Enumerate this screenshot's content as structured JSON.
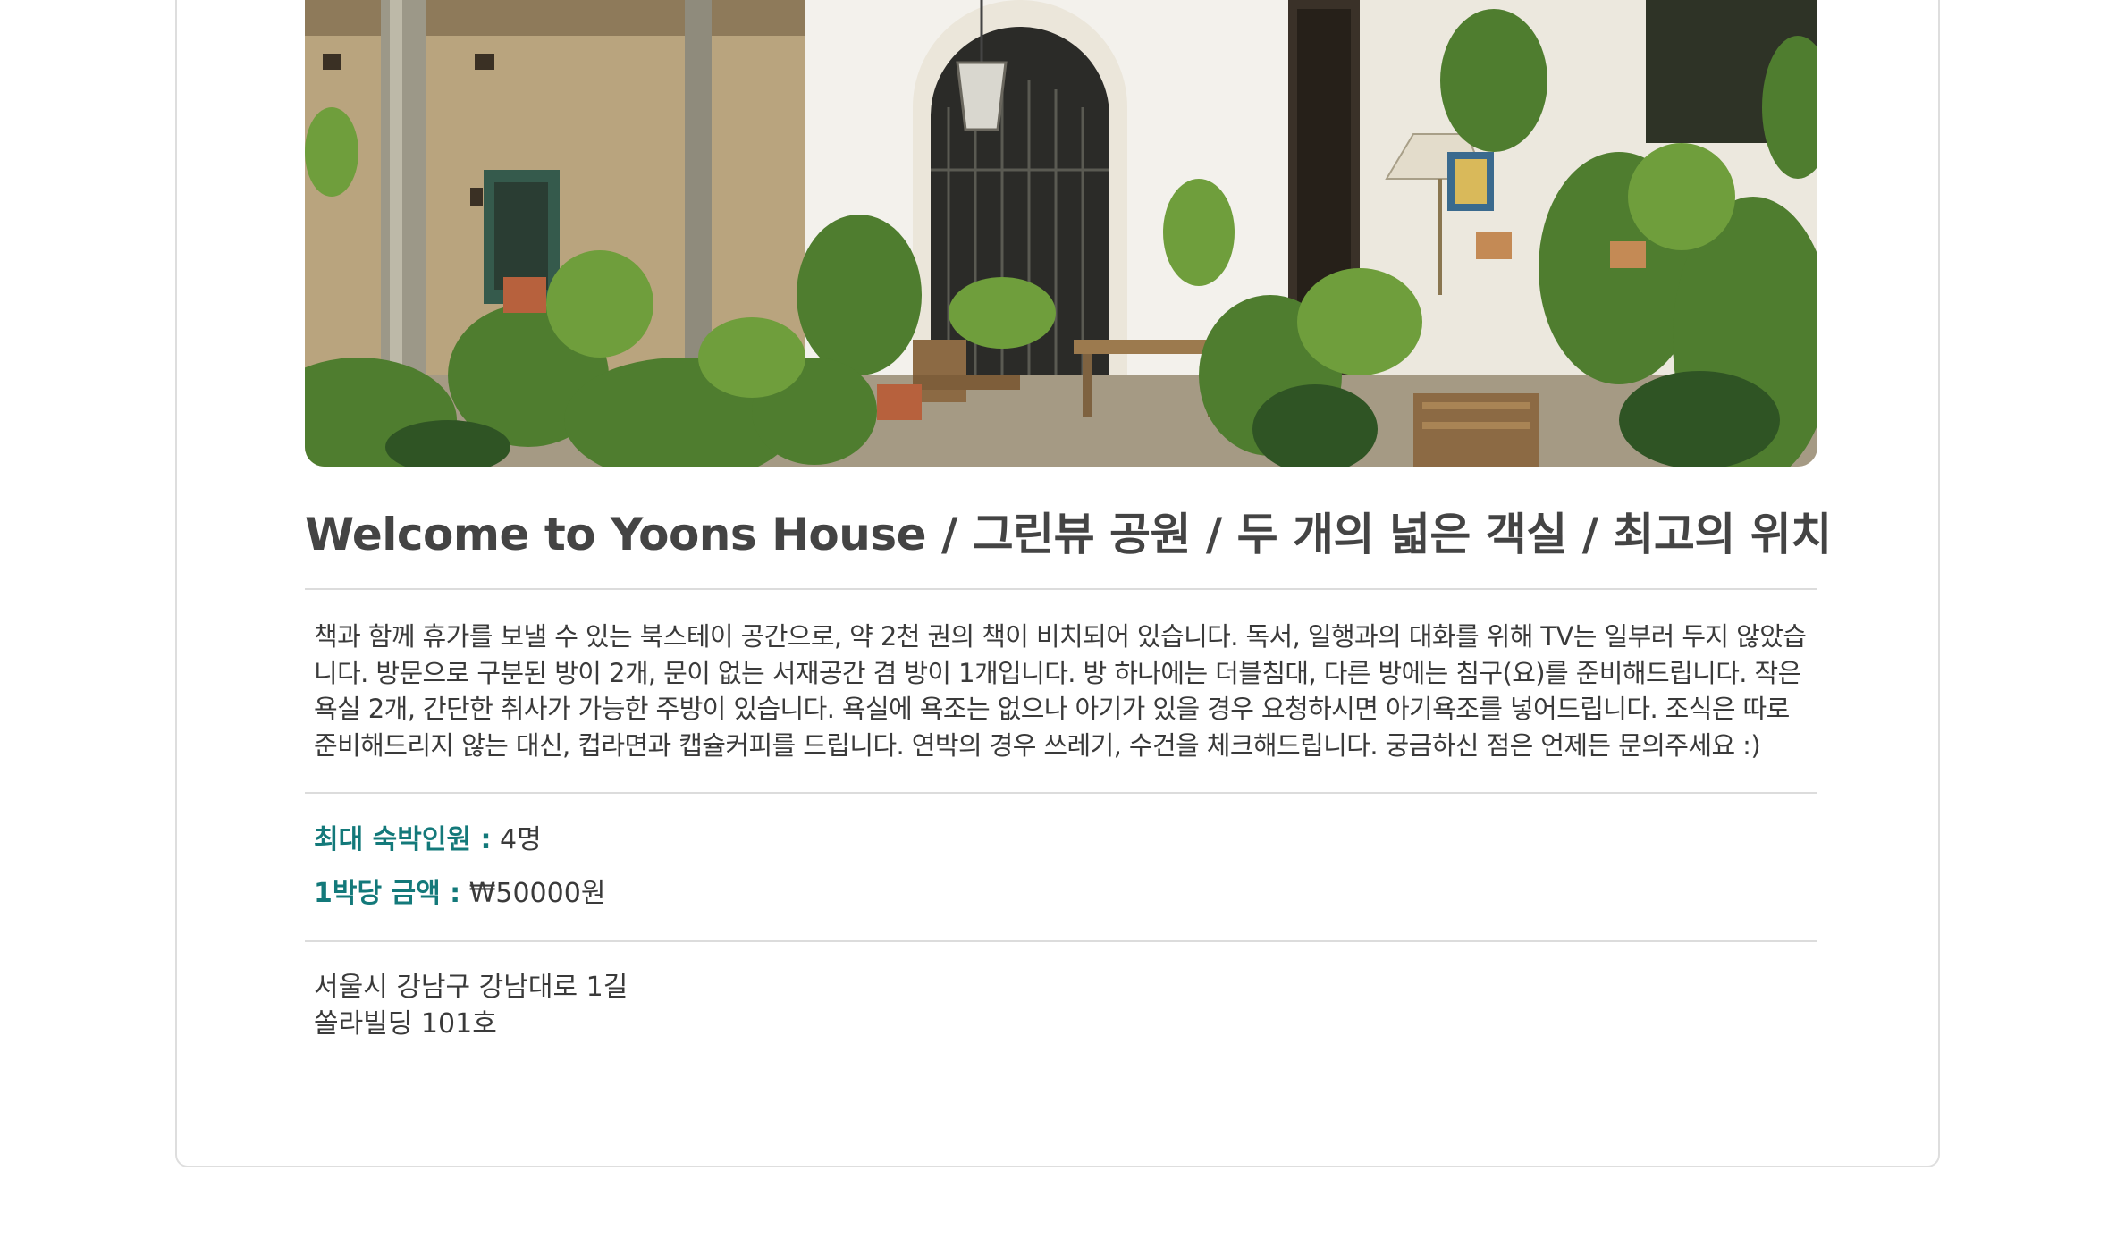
{
  "listing": {
    "photo": "covered terrace with potted plants, wooden table and chairs, arched iron gate",
    "title": "Welcome to Yoons House / 그린뷰 공원 / 두 개의 넓은 객실 / 최고의 위치",
    "description": "책과 함께 휴가를 보낼 수 있는 북스테이 공간으로, 약 2천 권의 책이 비치되어 있습니다. 독서, 일행과의 대화를 위해 TV는 일부러 두지 않았습니다. 방문으로 구분된 방이 2개, 문이 없는 서재공간 겸 방이 1개입니다. 방 하나에는 더블침대, 다른 방에는 침구(요)를 준비해드립니다. 작은 욕실 2개, 간단한 취사가 가능한 주방이 있습니다. 욕실에 욕조는 없으나 아기가 있을 경우 요청하시면 아기욕조를 넣어드립니다. 조식은 따로 준비해드리지 않는 대신, 컵라면과 캡슐커피를 드립니다. 연박의 경우 쓰레기, 수건을 체크해드립니다. 궁금하신 점은 언제든 문의주세요 :)",
    "max_guests_label": "최대 숙박인원 :",
    "max_guests_value": "4명",
    "price_label": "1박당 금액 :",
    "price_value": "₩50000원",
    "address_line1": "서울시 강남구 강남대로 1길",
    "address_line2": "쏠라빌딩 101호"
  },
  "colors": {
    "accent": "#13797a",
    "text": "#3a3a3a",
    "title": "#444444",
    "divider": "#dcdcdc",
    "card_border": "#dedede"
  }
}
